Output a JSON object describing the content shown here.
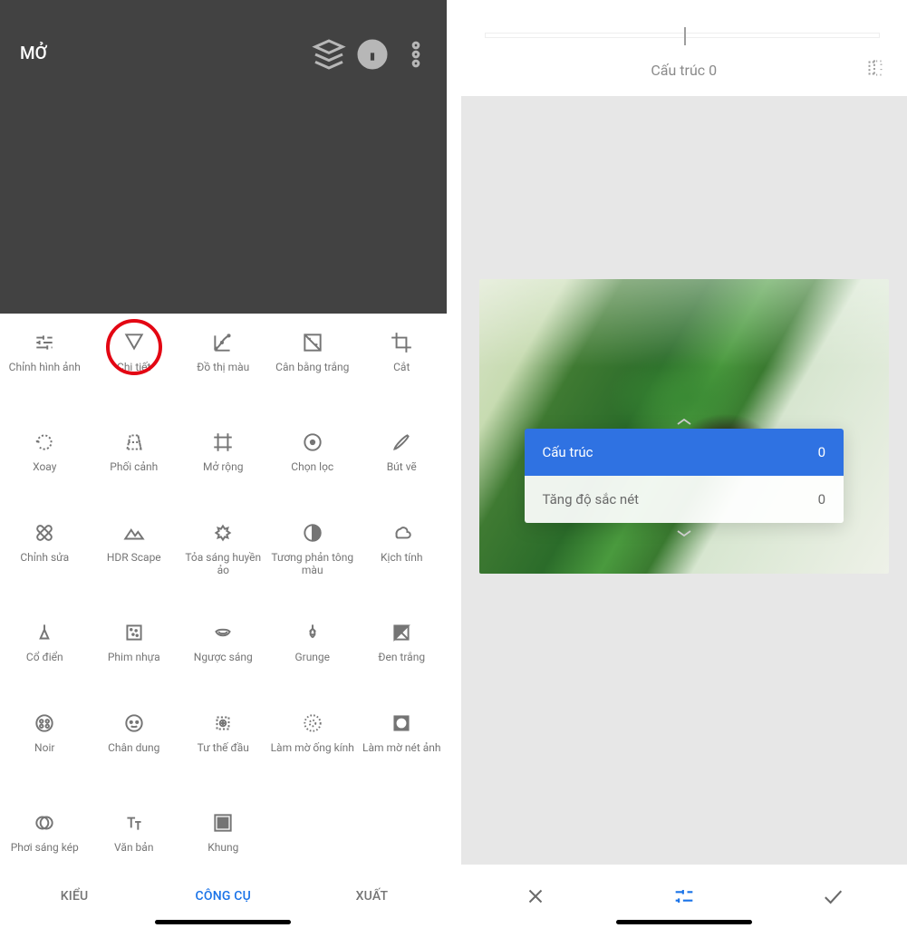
{
  "left": {
    "open_label": "MỞ",
    "tools_rows": [
      [
        {
          "label": "Chỉnh hình ảnh",
          "icon": "tune"
        },
        {
          "label": "Chi tiết",
          "icon": "details",
          "circled": true
        },
        {
          "label": "Đồ thị màu",
          "icon": "curves"
        },
        {
          "label": "Cân bằng trắng",
          "icon": "wb"
        },
        {
          "label": "Cắt",
          "icon": "crop"
        }
      ],
      [
        {
          "label": "Xoay",
          "icon": "rotate"
        },
        {
          "label": "Phối cảnh",
          "icon": "perspective"
        },
        {
          "label": "Mở rộng",
          "icon": "expand"
        },
        {
          "label": "Chọn lọc",
          "icon": "selective"
        },
        {
          "label": "Bút vẽ",
          "icon": "brush"
        }
      ],
      [
        {
          "label": "Chỉnh sửa",
          "icon": "heal"
        },
        {
          "label": "HDR Scape",
          "icon": "hdr"
        },
        {
          "label": "Tỏa sáng huyền ảo",
          "icon": "glamour"
        },
        {
          "label": "Tương phản tông màu",
          "icon": "tonal"
        },
        {
          "label": "Kịch tính",
          "icon": "drama"
        }
      ],
      [
        {
          "label": "Cổ điển",
          "icon": "vintage"
        },
        {
          "label": "Phim nhựa",
          "icon": "grainy"
        },
        {
          "label": "Ngược sáng",
          "icon": "retrolux"
        },
        {
          "label": "Grunge",
          "icon": "grunge"
        },
        {
          "label": "Đen trắng",
          "icon": "bw"
        }
      ],
      [
        {
          "label": "Noir",
          "icon": "noir"
        },
        {
          "label": "Chân dung",
          "icon": "portrait"
        },
        {
          "label": "Tư thế đầu",
          "icon": "headpose"
        },
        {
          "label": "Làm mờ ống kính",
          "icon": "lensblur"
        },
        {
          "label": "Làm mờ nét ảnh",
          "icon": "vignette"
        }
      ],
      [
        {
          "label": "Phơi sáng kép",
          "icon": "double"
        },
        {
          "label": "Văn bản",
          "icon": "text"
        },
        {
          "label": "Khung",
          "icon": "frame"
        },
        {
          "label": "",
          "icon": ""
        },
        {
          "label": "",
          "icon": ""
        }
      ]
    ],
    "bottom_tabs": {
      "styles": "KIỂU",
      "tools": "CÔNG CỤ",
      "export": "XUẤT"
    }
  },
  "right": {
    "slider_label": "Cấu trúc 0",
    "params": [
      {
        "name": "Cấu trúc",
        "value": "0",
        "selected": true
      },
      {
        "name": "Tăng độ sắc nét",
        "value": "0",
        "selected": false
      }
    ]
  }
}
